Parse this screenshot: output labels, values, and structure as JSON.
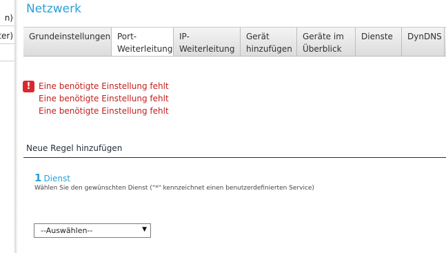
{
  "sidebar": {
    "items": [
      {
        "label": "n)"
      },
      {
        "label": "ter)"
      }
    ]
  },
  "page": {
    "title": "Netzwerk"
  },
  "tabs": [
    {
      "line1": "Grundeinstellungen",
      "line2": ""
    },
    {
      "line1": "Port-",
      "line2": "Weiterleitung",
      "active": true
    },
    {
      "line1": "IP-",
      "line2": "Weiterleitung"
    },
    {
      "line1": "Gerät",
      "line2": "hinzufügen"
    },
    {
      "line1": "Geräte im",
      "line2": "Überblick"
    },
    {
      "line1": "Dienste",
      "line2": ""
    },
    {
      "line1": "DynDNS",
      "line2": ""
    }
  ],
  "errors": {
    "icon": "exclamation-icon",
    "color": "#c41c1c",
    "messages": [
      "Eine benötigte Einstellung fehlt",
      "Eine benötigte Einstellung fehlt",
      "Eine benötigte Einstellung fehlt"
    ]
  },
  "section": {
    "title": "Neue Regel hinzufügen",
    "step": {
      "number": "1",
      "label": "Dienst",
      "description": "Wählen Sie den gewünschten Dienst (\"*\" kennzeichnet einen benutzerdefinierten Service)"
    },
    "select": {
      "value": "--Auswählen--"
    }
  },
  "colors": {
    "accent": "#2aa0d8",
    "error": "#c41c1c"
  }
}
